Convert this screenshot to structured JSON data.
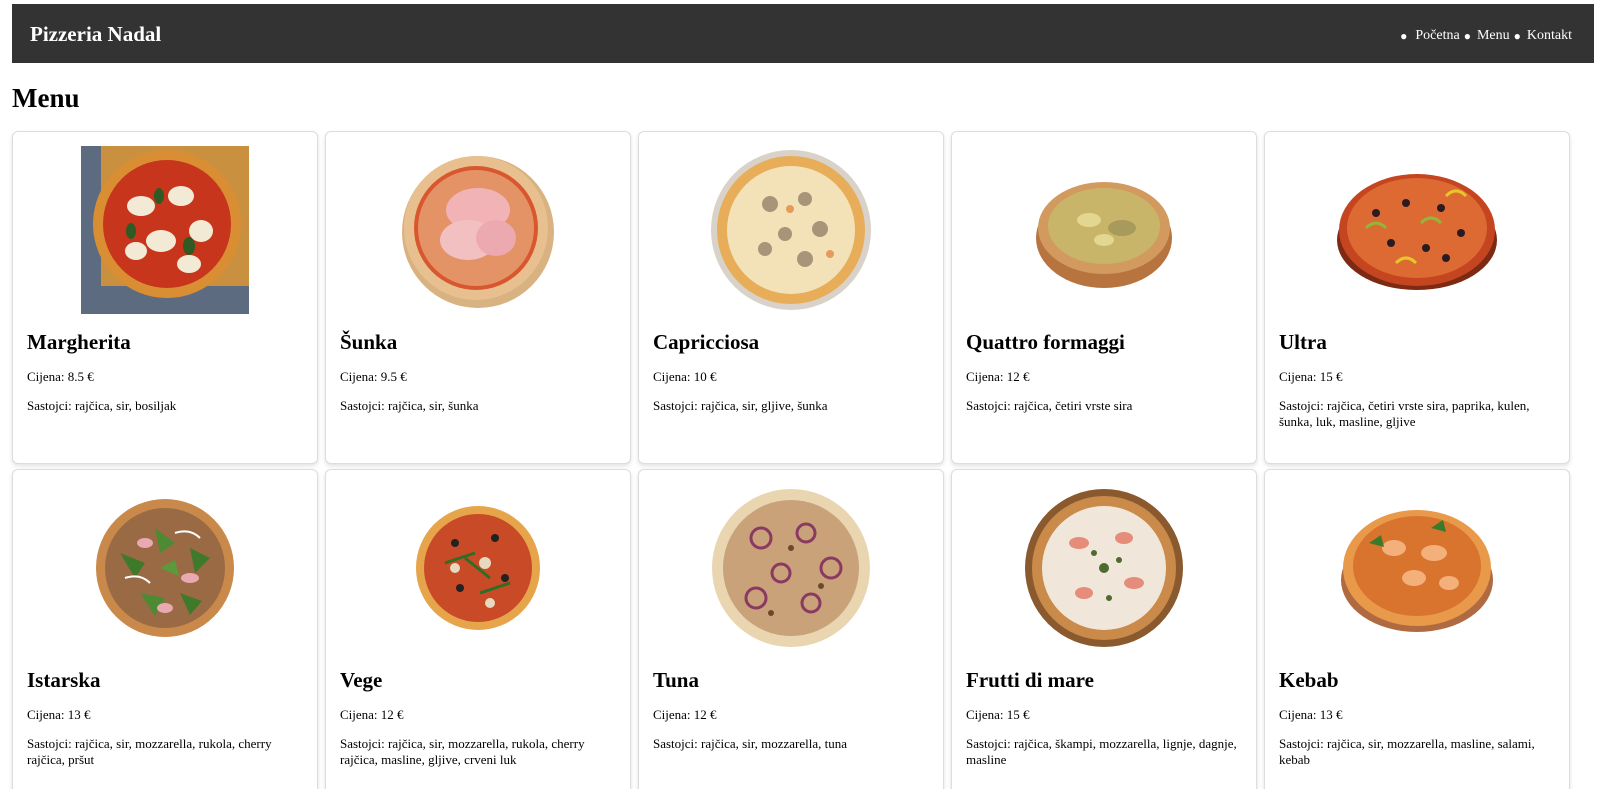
{
  "brand": "Pizzeria Nadal",
  "nav": [
    "Početna",
    "Menu",
    "Kontakt"
  ],
  "page_title": "Menu",
  "price_prefix": "Cijena:",
  "ingredients_prefix": "Sastojci:",
  "pizzas": [
    {
      "name": "Margherita",
      "price": "Cijena: 8.5 €",
      "ingredients": "Sastojci: rajčica, sir, bosiljak"
    },
    {
      "name": "Šunka",
      "price": "Cijena: 9.5 €",
      "ingredients": "Sastojci: rajčica, sir, šunka"
    },
    {
      "name": "Capricciosa",
      "price": "Cijena: 10 €",
      "ingredients": "Sastojci: rajčica, sir, gljive, šunka"
    },
    {
      "name": "Quattro formaggi",
      "price": "Cijena: 12 €",
      "ingredients": "Sastojci: rajčica, četiri vrste sira"
    },
    {
      "name": "Ultra",
      "price": "Cijena: 15 €",
      "ingredients": "Sastojci: rajčica, četiri vrste sira, paprika, kulen, šunka, luk, masline, gljive"
    },
    {
      "name": "Istarska",
      "price": "Cijena: 13 €",
      "ingredients": "Sastojci: rajčica, sir, mozzarella, rukola, cherry rajčica, pršut"
    },
    {
      "name": "Vege",
      "price": "Cijena: 12 €",
      "ingredients": "Sastojci: rajčica, sir, mozzarella, rukola, cherry rajčica, masline, gljive, crveni luk"
    },
    {
      "name": "Tuna",
      "price": "Cijena: 12 €",
      "ingredients": "Sastojci: rajčica, sir, mozzarella, tuna"
    },
    {
      "name": "Frutti di mare",
      "price": "Cijena: 15 €",
      "ingredients": "Sastojci: rajčica, škampi, mozzarella, lignje, dagnje, masline"
    },
    {
      "name": "Kebab",
      "price": "Cijena: 13 €",
      "ingredients": "Sastojci: rajčica, sir, mozzarella, masline, salami, kebab"
    }
  ],
  "colors": {
    "navbar_bg": "#333333",
    "navbar_text": "#ffffff",
    "card_border": "#dddddd"
  }
}
